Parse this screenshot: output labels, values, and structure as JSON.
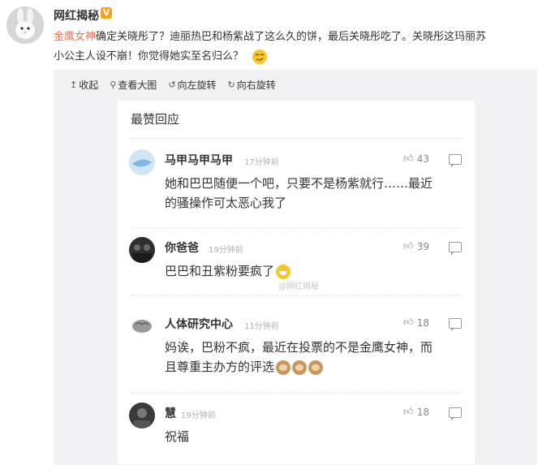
{
  "post": {
    "author": "网红揭秘",
    "verified_badge": "V",
    "tag": "金鹰女神",
    "text_line1": "确定关晓彤了？迪丽热巴和杨紫战了这么久的饼，最后关晓彤吃了。关晓彤这玛丽苏",
    "text_line2": "小公主人设不崩！你觉得她实至名归么？",
    "emoji": "smirk-face"
  },
  "toolbar": {
    "items": [
      {
        "icon": "↥",
        "label": "收起"
      },
      {
        "icon": "⚲",
        "label": "查看大图"
      },
      {
        "icon": "↺",
        "label": "向左旋转"
      },
      {
        "icon": "↻",
        "label": "向右旋转"
      }
    ]
  },
  "card": {
    "title": "最赞回应",
    "watermark": "@网红揭秘",
    "comments": [
      {
        "name": "马甲马甲马甲",
        "time": "17分钟前",
        "likes": "43",
        "line1": "她和巴巴随便一个吧，只要不是杨紫就行……最近",
        "line2": "的骚操作可太恶心我了",
        "avatar_color": "#a9cfee"
      },
      {
        "name": "你爸爸",
        "time": "19分钟前",
        "likes": "39",
        "line1": "巴巴和丑紫粉要疯了",
        "line2": "",
        "avatar_color": "#3a3a3a"
      },
      {
        "name": "人体研究中心",
        "time": "11分钟前",
        "likes": "18",
        "line1": "妈诶，巴粉不疯，最近在投票的不是金鹰女神，而",
        "line2": "且尊重主办方的评选",
        "avatar_color": "#8a8a8a"
      },
      {
        "name": "慧",
        "time": "19分钟前",
        "likes": "18",
        "line1": "祝福",
        "line2": "",
        "avatar_color": "#444444"
      }
    ]
  }
}
